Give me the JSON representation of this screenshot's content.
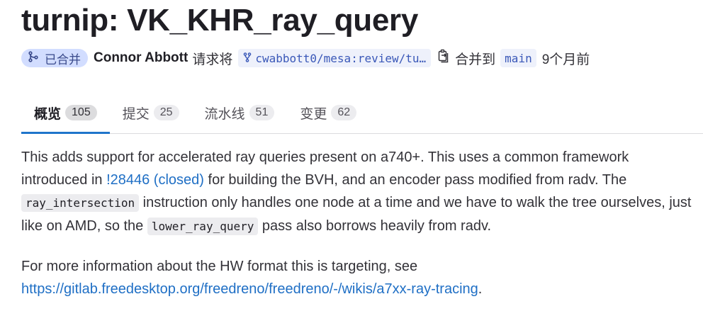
{
  "title": "turnip: VK_KHR_ray_query",
  "meta": {
    "status_label": "已合并",
    "author": "Connor Abbott",
    "request_verb": "请求将",
    "source_branch": "cwabbott0/mesa:review/tu…",
    "merge_into_label": "合并到",
    "target_branch": "main",
    "time_ago": "9个月前"
  },
  "tabs": [
    {
      "label": "概览",
      "count": "105"
    },
    {
      "label": "提交",
      "count": "25"
    },
    {
      "label": "流水线",
      "count": "51"
    },
    {
      "label": "变更",
      "count": "62"
    }
  ],
  "description": {
    "p1_part1": "This adds support for accelerated ray queries present on a740+. This uses a common framework introduced in ",
    "p1_link": "!28446 (closed)",
    "p1_part2": " for building the BVH, and an encoder pass modified from radv. The ",
    "p1_code1": "ray_intersection",
    "p1_part3": " instruction only handles one node at a time and we have to walk the tree ourselves, just like on AMD, so the ",
    "p1_code2": "lower_ray_query",
    "p1_part4": " pass also borrows heavily from radv.",
    "p2_part1": "For more information about the HW format this is targeting, see ",
    "p2_link": "https://gitlab.freedesktop.org/freedreno/freedreno/-/wikis/a7xx-ray-tracing",
    "p2_part2": "."
  },
  "colors": {
    "accent": "#1f75cb",
    "merged_badge_bg": "#d2ddff",
    "link": "#1f6fc5"
  },
  "icons": {
    "merged": "merge-request-icon",
    "branch": "branch-icon",
    "copy": "copy-icon"
  }
}
